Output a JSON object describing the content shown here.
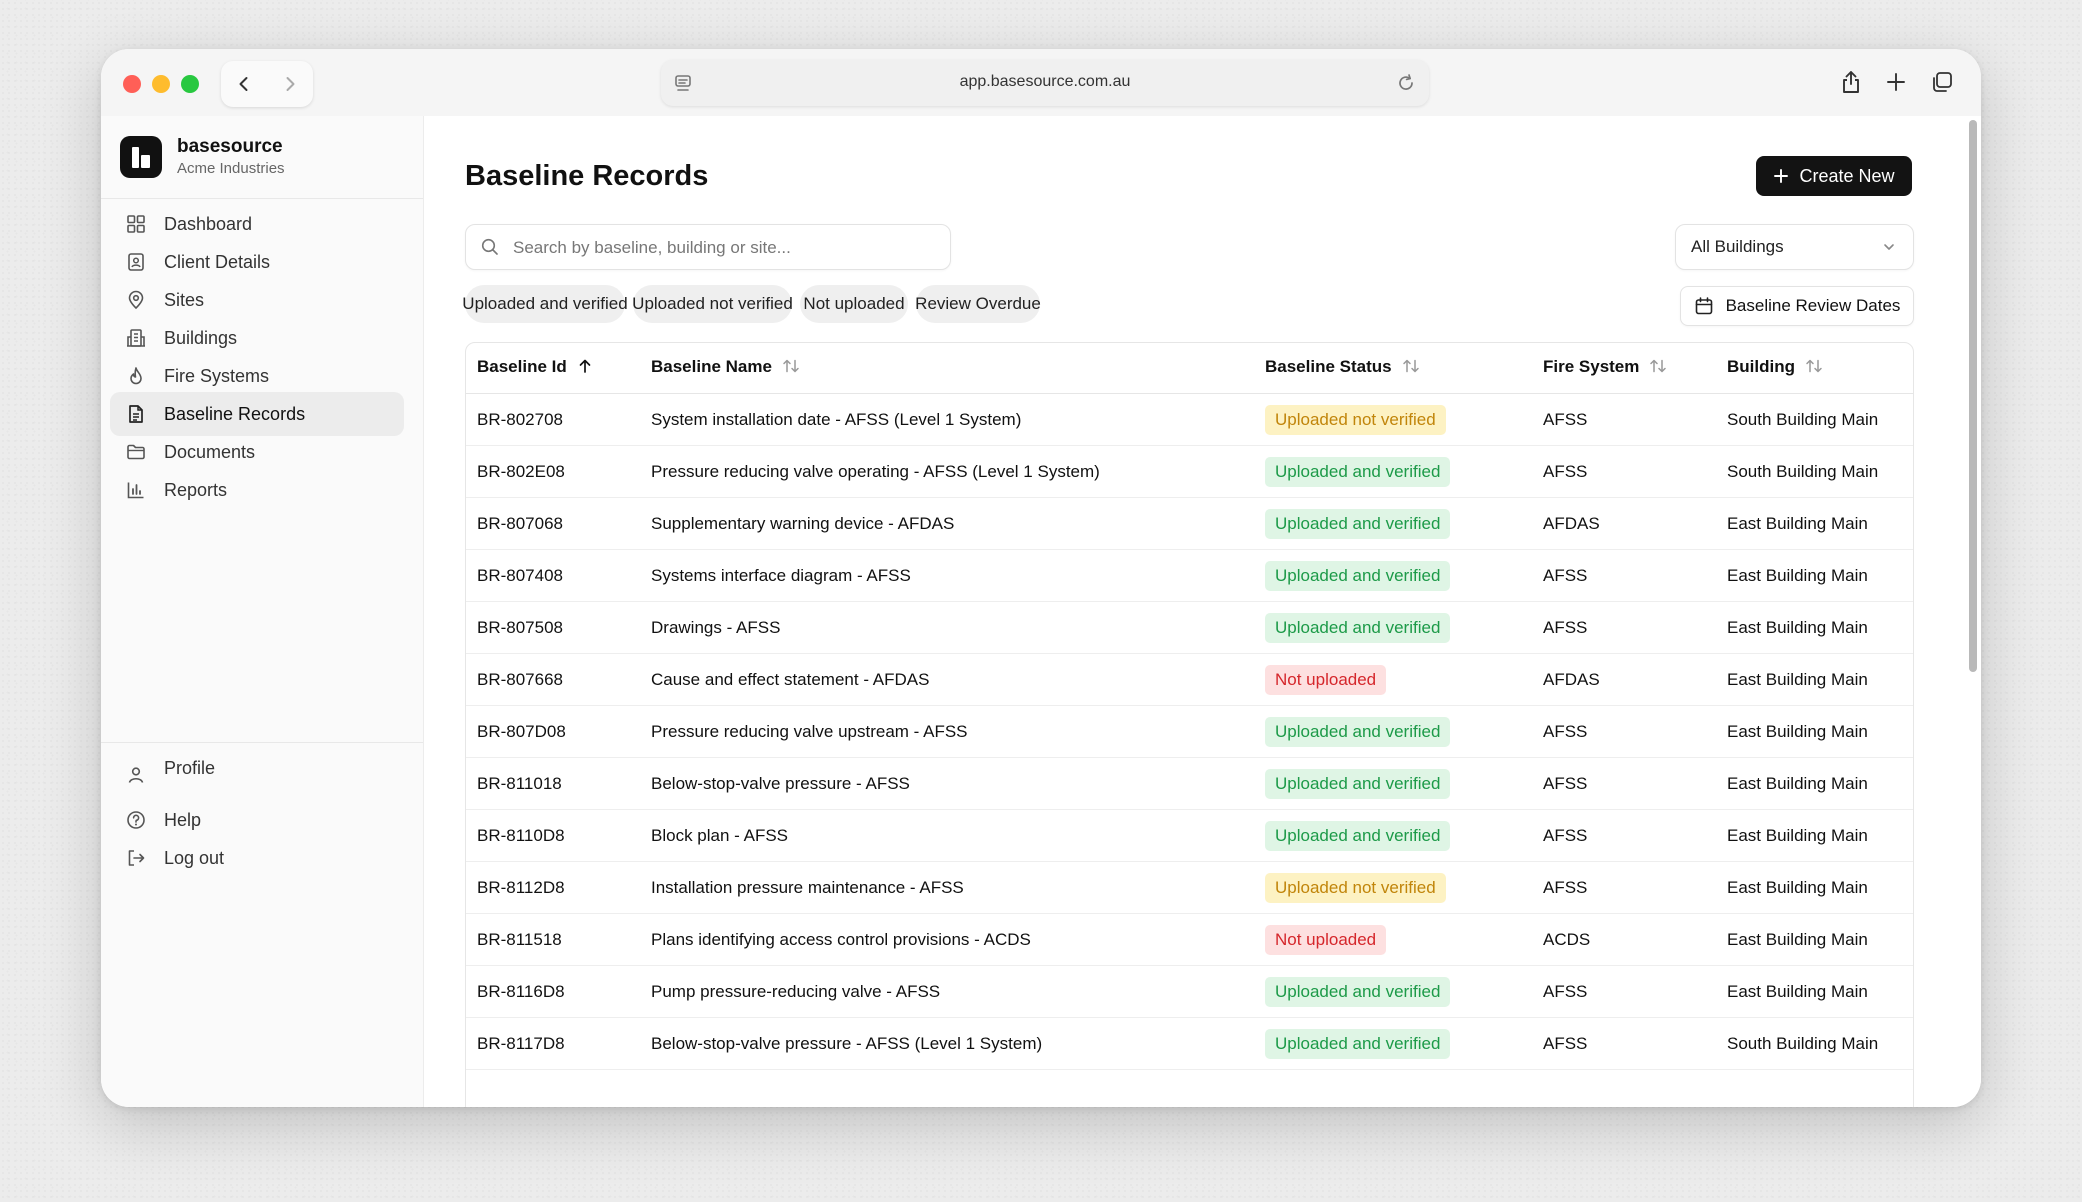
{
  "browser": {
    "url": "app.basesource.com.au"
  },
  "brand": {
    "name": "basesource",
    "org": "Acme Industries"
  },
  "nav": [
    {
      "label": "Dashboard",
      "icon": "grid-icon"
    },
    {
      "label": "Client Details",
      "icon": "id-card-icon"
    },
    {
      "label": "Sites",
      "icon": "map-pin-icon"
    },
    {
      "label": "Buildings",
      "icon": "building-icon"
    },
    {
      "label": "Fire Systems",
      "icon": "flame-icon"
    },
    {
      "label": "Baseline Records",
      "icon": "file-text-icon",
      "active": true
    },
    {
      "label": "Documents",
      "icon": "folder-icon"
    },
    {
      "label": "Reports",
      "icon": "bar-chart-icon"
    }
  ],
  "nav_bottom": [
    {
      "label": "Profile",
      "icon": "user-icon"
    },
    {
      "label": "Help",
      "icon": "help-circle-icon"
    },
    {
      "label": "Log out",
      "icon": "log-out-icon"
    }
  ],
  "page": {
    "title": "Baseline Records",
    "create_label": "Create New",
    "search_placeholder": "Search by baseline, building or site...",
    "building_filter": "All Buildings",
    "review_dates_label": "Baseline Review Dates"
  },
  "filters": [
    "Uploaded and verified",
    "Uploaded not verified",
    "Not uploaded",
    "Review Overdue"
  ],
  "table": {
    "columns": [
      "Baseline Id",
      "Baseline Name",
      "Baseline Status",
      "Fire System",
      "Building"
    ],
    "rows": [
      {
        "id": "BR-802708",
        "name": "System installation date - AFSS (Level 1 System)",
        "status": "Uploaded not verified",
        "system": "AFSS",
        "building": "South Building Main"
      },
      {
        "id": "BR-802E08",
        "name": "Pressure reducing valve operating - AFSS (Level 1 System)",
        "status": "Uploaded and verified",
        "system": "AFSS",
        "building": "South Building Main"
      },
      {
        "id": "BR-807068",
        "name": "Supplementary warning device - AFDAS",
        "status": "Uploaded and verified",
        "system": "AFDAS",
        "building": "East Building Main"
      },
      {
        "id": "BR-807408",
        "name": "Systems interface diagram - AFSS",
        "status": "Uploaded and verified",
        "system": "AFSS",
        "building": "East Building Main"
      },
      {
        "id": "BR-807508",
        "name": "Drawings - AFSS",
        "status": "Uploaded and verified",
        "system": "AFSS",
        "building": "East Building Main"
      },
      {
        "id": "BR-807668",
        "name": "Cause and effect statement - AFDAS",
        "status": "Not uploaded",
        "system": "AFDAS",
        "building": "East Building Main"
      },
      {
        "id": "BR-807D08",
        "name": "Pressure reducing valve upstream - AFSS",
        "status": "Uploaded and verified",
        "system": "AFSS",
        "building": "East Building Main"
      },
      {
        "id": "BR-811018",
        "name": "Below-stop-valve pressure - AFSS",
        "status": "Uploaded and verified",
        "system": "AFSS",
        "building": "East Building Main"
      },
      {
        "id": "BR-8110D8",
        "name": "Block plan - AFSS",
        "status": "Uploaded and verified",
        "system": "AFSS",
        "building": "East Building Main"
      },
      {
        "id": "BR-8112D8",
        "name": "Installation pressure maintenance - AFSS",
        "status": "Uploaded not verified",
        "system": "AFSS",
        "building": "East Building Main"
      },
      {
        "id": "BR-811518",
        "name": "Plans identifying access control provisions - ACDS",
        "status": "Not uploaded",
        "system": "ACDS",
        "building": "East Building Main"
      },
      {
        "id": "BR-8116D8",
        "name": "Pump pressure-reducing valve - AFSS",
        "status": "Uploaded and verified",
        "system": "AFSS",
        "building": "East Building Main"
      },
      {
        "id": "BR-8117D8",
        "name": "Below-stop-valve pressure - AFSS (Level 1 System)",
        "status": "Uploaded and verified",
        "system": "AFSS",
        "building": "South Building Main"
      }
    ]
  },
  "colors": {
    "verified_bg": "#dff5e5",
    "verified_fg": "#1c9a48",
    "unverified_bg": "#fdf2c3",
    "unverified_fg": "#c1850a",
    "missing_bg": "#fde0e0",
    "missing_fg": "#d5262b",
    "primary_button": "#131313"
  }
}
